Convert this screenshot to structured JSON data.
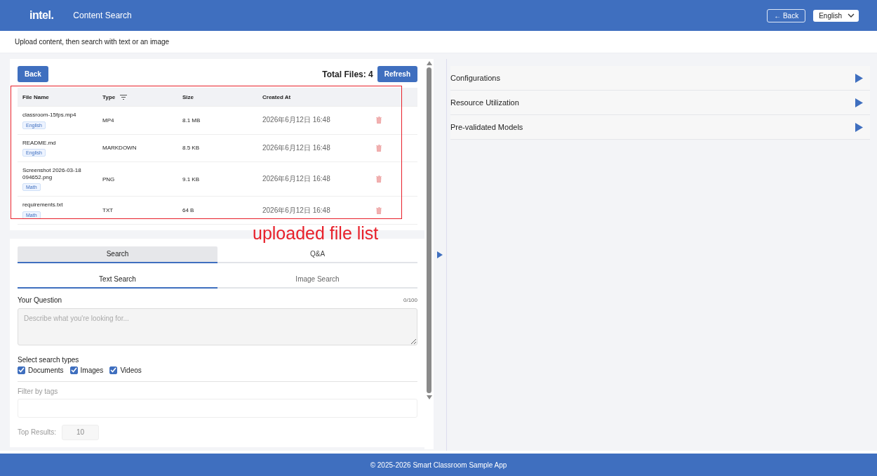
{
  "header": {
    "logo": "intel.",
    "title": "Content Search",
    "back_button": "← Back",
    "language": {
      "value": "English"
    }
  },
  "subtitle": "Upload content, then search with text or an image",
  "file_card": {
    "back_button": "Back",
    "total_files": "Total Files: 4",
    "refresh_button": "Refresh",
    "columns": [
      "File Name",
      "Type",
      "Size",
      "Created At"
    ],
    "rows": [
      {
        "name": "classroom-15fps.mp4",
        "tag": "English",
        "type": "MP4",
        "size": "8.1 MB",
        "created": "2026年6月12日 16:48"
      },
      {
        "name": "README.md",
        "tag": "English",
        "type": "MARKDOWN",
        "size": "8.5 KB",
        "created": "2026年6月12日 16:48"
      },
      {
        "name": "Screenshot 2026-03-18 094652.png",
        "tag": "Math",
        "type": "PNG",
        "size": "9.1 KB",
        "created": "2026年6月12日 16:48"
      },
      {
        "name": "requirements.txt",
        "tag": "Math",
        "type": "TXT",
        "size": "64 B",
        "created": "2026年6月12日 16:48"
      }
    ]
  },
  "annotation": {
    "label": "uploaded file list"
  },
  "search_card": {
    "mode_tabs": [
      {
        "label": "Search",
        "selected": true
      },
      {
        "label": "Q&A",
        "selected": false
      }
    ],
    "search_tabs": [
      {
        "label": "Text Search",
        "selected": true
      },
      {
        "label": "Image Search",
        "selected": false
      }
    ],
    "question": {
      "label": "Your Question",
      "counter": "0/100",
      "placeholder": "Describe what you're looking for..."
    },
    "search_types": {
      "label": "Select search types",
      "options": [
        {
          "label": "Documents",
          "checked": true
        },
        {
          "label": "Images",
          "checked": true
        },
        {
          "label": "Videos",
          "checked": true
        }
      ]
    },
    "tags": {
      "label": "Filter by tags"
    },
    "top_results": {
      "label": "Top Results:",
      "placeholder": "10"
    }
  },
  "side_panel": {
    "sections": [
      {
        "label": "Configurations",
        "expanded": false
      },
      {
        "label": "Resource Utilization",
        "expanded": false
      },
      {
        "label": "Pre-validated Models",
        "expanded": false
      }
    ]
  },
  "footer": "© 2025-2026 Smart Classroom Sample App"
}
